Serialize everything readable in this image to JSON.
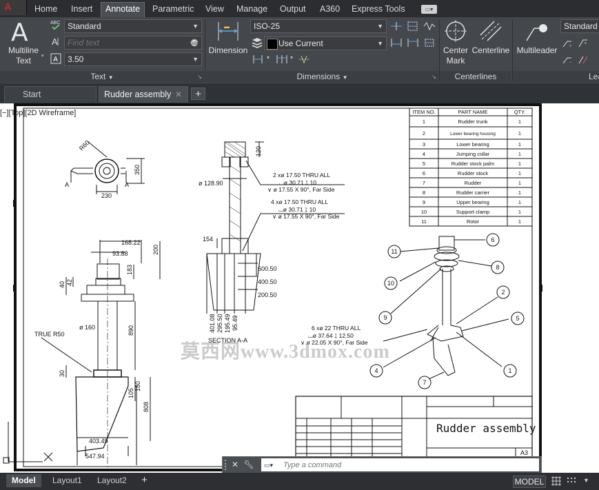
{
  "menu": {
    "tabs": [
      "Home",
      "Insert",
      "Annotate",
      "Parametric",
      "View",
      "Manage",
      "Output",
      "A360",
      "Express Tools"
    ],
    "active_tab": "Annotate"
  },
  "ribbon": {
    "text_panel": {
      "multiline_text_label_1": "Multiline",
      "multiline_text_label_2": "Text",
      "text_style": "Standard",
      "find_text_placeholder": "Find text",
      "text_height": "3.50",
      "title": "Text"
    },
    "dimensions_panel": {
      "dimension_label": "Dimension",
      "dim_style": "ISO-25",
      "layer": "Use Current",
      "title": "Dimensions"
    },
    "centerlines_panel": {
      "center_mark_label_1": "Center",
      "center_mark_label_2": "Mark",
      "centerline_label": "Centerline",
      "title": "Centerlines"
    },
    "leaders_panel": {
      "multileader_label": "Multileader",
      "leader_style": "Standard",
      "title": "Lea"
    }
  },
  "document_tabs": [
    {
      "label": "Start"
    },
    {
      "label": "Rudder assembly"
    }
  ],
  "viewport": {
    "label": "[−][Top][2D Wireframe]",
    "watermark": "莫西网www.3dmox.com"
  },
  "drawing": {
    "parts_table": {
      "headers": [
        "ITEM NO.",
        "PART NAME",
        "QTY."
      ],
      "rows": [
        [
          "1",
          "Rudder trunk",
          "1"
        ],
        [
          "2",
          "Lower bearing housing",
          "1"
        ],
        [
          "3",
          "Lower bearing",
          "1"
        ],
        [
          "4",
          "Jumping collar",
          "1"
        ],
        [
          "5",
          "Rudder stock palm",
          "1"
        ],
        [
          "6",
          "Rudder stock",
          "1"
        ],
        [
          "7",
          "Rudder",
          "1"
        ],
        [
          "8",
          "Rudder carrier",
          "1"
        ],
        [
          "9",
          "Upper bearing",
          "1"
        ],
        [
          "10",
          "Support clamp",
          "1"
        ],
        [
          "11",
          "Rotor",
          "1"
        ]
      ]
    },
    "dimensions": {
      "r60": "R60",
      "d350": "350",
      "d230": "230",
      "a_left": "A",
      "a_right": "A",
      "d16822": "168.22",
      "d9388": "93.88",
      "d200": "200",
      "d183": "183",
      "d42": "42",
      "d40": "40",
      "d890": "890",
      "d160": "ø 160",
      "true_r50": "TRUE R50",
      "d30": "30",
      "d180": "180",
      "d105": "105",
      "d808": "808",
      "d40349": "403.49",
      "d54794": "547.94",
      "d12890": "ø 128.90",
      "d120": "120",
      "d154": "154",
      "d60050": "600.50",
      "d40050": "400.50",
      "d20050": "200.50",
      "d40108": "401.08",
      "d29550": "295.50",
      "d19549": "195.49",
      "d9549": "95.49",
      "section": "SECTION A-A"
    },
    "callouts": {
      "holes_a_1": "2 xø 17.50 THRU ALL",
      "holes_a_2": "⌴ø 30.71 ↧ 10",
      "holes_a_3": "∨ ø 17.55 X 90°, Far Side",
      "holes_b_1": "4 xø 17.50 THRU ALL",
      "holes_b_2": "⌴ø 30.71 ↧ 10",
      "holes_b_3": "∨ ø 17.55 X 90°, Far Side",
      "holes_c_1": "6 xø 22 THRU ALL",
      "holes_c_2": "⌴ø 37.64 ↧ 12.50",
      "holes_c_3": "∨ ø 22.05 X 90°, Far Side"
    },
    "balloons": [
      "6",
      "11",
      "8",
      "10",
      "2",
      "9",
      "5",
      "1",
      "4",
      "7"
    ],
    "title_block": {
      "title": "Rudder assembly",
      "sheet": "A3"
    }
  },
  "command_line": {
    "placeholder": "Type a command"
  },
  "status": {
    "layout_tabs": [
      "Model",
      "Layout1",
      "Layout2"
    ],
    "model_button": "MODEL"
  },
  "colors": {
    "ribbon_bg": "#44474c",
    "menubar_bg": "#2b2d31",
    "accent_active_tab": "#4a4d52",
    "drawing_ink": "#111111"
  }
}
